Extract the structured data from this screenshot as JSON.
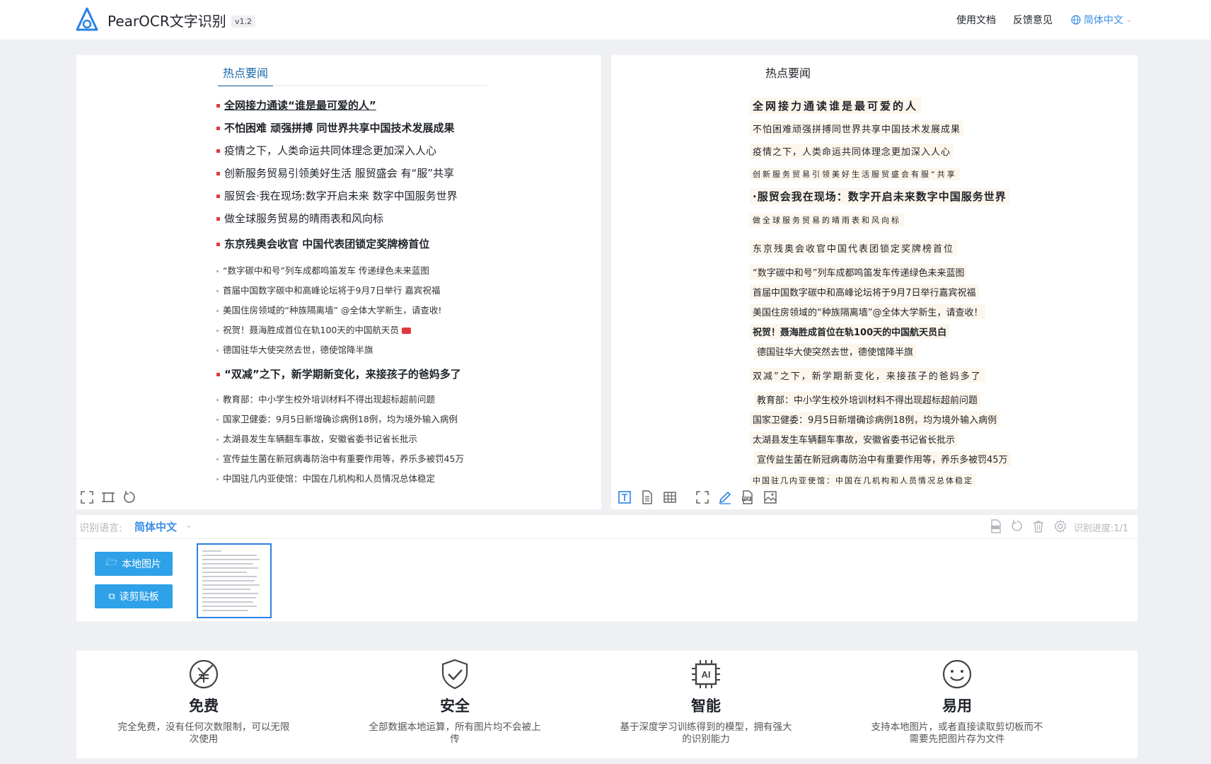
{
  "header": {
    "app_title": "PearOCR文字识别",
    "version": "v1.2",
    "nav": [
      {
        "label": "使用文档"
      },
      {
        "label": "反馈意见"
      }
    ],
    "language": "简体中文"
  },
  "image_panel": {
    "tab": "热点要闻",
    "news": [
      {
        "text": "全网接力通读“谁是最可爱的人”"
      },
      {
        "text": "不怕困难 顽强拼搏 同世界共享中国技术发展成果"
      },
      {
        "text": "疫情之下，人类命运共同体理念更加深入人心"
      },
      {
        "text": "创新服务贸易引领美好生活 服贸盛会 有“服”共享"
      },
      {
        "text": "服贸会·我在现场:数字开启未来 数字中国服务世界"
      },
      {
        "text": "做全球服务贸易的晴雨表和风向标"
      },
      {
        "text": "东京残奥会收官 中国代表团锁定奖牌榜首位"
      },
      {
        "text": "“数字碳中和号”列车成都鸣笛发车 传递绿色未来蓝图"
      },
      {
        "text": "首届中国数字碳中和高峰论坛将于9月7日举行 嘉宾祝福"
      },
      {
        "text": "美国住房领域的“种族隔离墙” @全体大学新生，请查收!"
      },
      {
        "text": "祝贺！聂海胜成首位在轨100天的中国航天员"
      },
      {
        "text": "德国驻华大使突然去世，德使馆降半旗"
      },
      {
        "text": "“双减”之下，新学期新变化，来接孩子的爸妈多了"
      },
      {
        "text": "教育部：中小学生校外培训材料不得出现超标超前问题"
      },
      {
        "text": "国家卫健委：9月5日新增确诊病例18例，均为境外输入病例"
      },
      {
        "text": "太湖县发生车辆翻车事故，安徽省委书记省长批示"
      },
      {
        "text": "宣传益生菌在新冠病毒防治中有重要作用等，养乐多被罚45万"
      },
      {
        "text": "中国驻几内亚使馆：中国在几机构和人员情况总体稳定"
      }
    ]
  },
  "text_panel": {
    "title": "热点要闻",
    "lines": [
      {
        "text": "全网接力通读谁是最可爱的人"
      },
      {
        "text": "不怕困难顽强拼搏同世界共享中国技术发展成果"
      },
      {
        "text": "疫情之下，人类命运共同体理念更加深入人心"
      },
      {
        "text": "创新服务贸易引领美好生活服贸盛会有服“共享"
      },
      {
        "text": "·服贸会我在现场：数字开启未来数字中国服务世界"
      },
      {
        "text": "做全球服务贸易的晴雨表和风向标"
      },
      {
        "text": "东京残奥会收官中国代表团锁定奖牌榜首位"
      },
      {
        "text": "“数字碳中和号”列车成都鸣笛发车传递绿色未来蓝图"
      },
      {
        "text": "首届中国数字碳中和高峰论坛将于9月7日举行嘉宾祝福"
      },
      {
        "text": "美国住房领域的“种族隔离墙”@全体大学新生，请查收！"
      },
      {
        "text": "祝贺！聂海胜成首位在轨100天的中国航天员白"
      },
      {
        "text": "德国驻华大使突然去世，德使馆降半旗"
      },
      {
        "text": "双减”之下，新学期新变化，来接孩子的爸妈多了"
      },
      {
        "text": "教育部：中小学生校外培训材料不得出现超标超前问题"
      },
      {
        "text": "国家卫健委：9月5日新增确诊病例18例，均为境外输入病例"
      },
      {
        "text": "太湖县发生车辆翻车事故，安徽省委书记省长批示"
      },
      {
        "text": "宣传益生菌在新冠病毒防治中有重要作用等，养乐多被罚45万"
      },
      {
        "text": "中国驻几内亚使馆：中国在几机构和人员情况总体稳定"
      }
    ]
  },
  "tray": {
    "language_label": "识别语言:",
    "language_value": "简体中文",
    "local_image_button": "本地图片",
    "clipboard_button": "读剪贴板",
    "progress": "识别进度:1/1"
  },
  "features": [
    {
      "title": "免费",
      "desc": "完全免费，没有任何次数限制，可以无限次使用",
      "icon": "free-icon"
    },
    {
      "title": "安全",
      "desc": "全部数据本地运算，所有图片均不会被上传",
      "icon": "shield-check-icon"
    },
    {
      "title": "智能",
      "desc": "基于深度学习训练得到的模型，拥有强大的识别能力",
      "icon": "ai-chip-icon",
      "chip_text": "AI"
    },
    {
      "title": "易用",
      "desc": "支持本地图片，或者直接读取剪切板而不需要先把图片存为文件",
      "icon": "smile-icon"
    }
  ],
  "colors": {
    "accent": "#2a82e4",
    "button": "#2ea1e8",
    "bullet_red": "#e0383e",
    "ocr_highlight": "#fdf6ec",
    "page_bg": "#eef0f3"
  }
}
